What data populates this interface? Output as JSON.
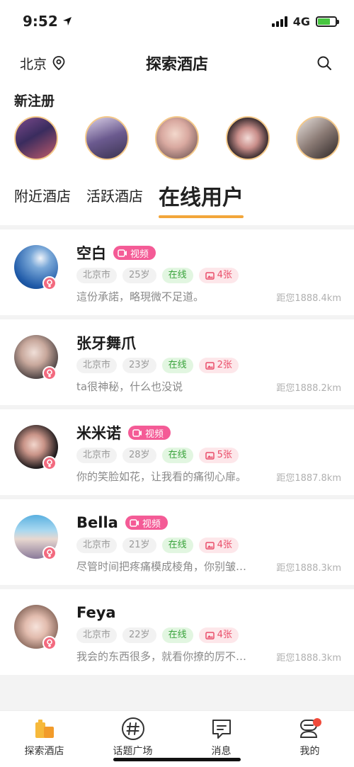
{
  "status_bar": {
    "time": "9:52",
    "network": "4G"
  },
  "header": {
    "city": "北京",
    "title": "探索酒店"
  },
  "new_users": {
    "title": "新注册"
  },
  "tabs": [
    {
      "label": "附近酒店"
    },
    {
      "label": "活跃酒店"
    },
    {
      "label": "在线用户"
    }
  ],
  "colors": {
    "accent": "#f2a63a",
    "video_badge": "#f45b96",
    "online": "#3ba43d",
    "photos": "#ea4e6a",
    "gender": "#f36a7f"
  },
  "users": [
    {
      "name": "空白",
      "video": "视频",
      "city": "北京市",
      "age": "25岁",
      "status": "在线",
      "photos": "4张",
      "signature": "這份承諾，略現微不足道。",
      "distance": "距您1888.4km"
    },
    {
      "name": "张牙舞爪",
      "video": "",
      "city": "北京市",
      "age": "23岁",
      "status": "在线",
      "photos": "2张",
      "signature": "ta很神秘，什么也没说",
      "distance": "距您1888.2km"
    },
    {
      "name": "米米诺",
      "video": "视频",
      "city": "北京市",
      "age": "28岁",
      "status": "在线",
      "photos": "5张",
      "signature": "你的笑脸如花，让我看的痛彻心扉。",
      "distance": "距您1887.8km"
    },
    {
      "name": "Bella",
      "video": "视频",
      "city": "北京市",
      "age": "21岁",
      "status": "在线",
      "photos": "4张",
      "signature": "尽管时间把疼痛模成棱角，你别皱…",
      "distance": "距您1888.3km"
    },
    {
      "name": "Feya",
      "video": "",
      "city": "北京市",
      "age": "22岁",
      "status": "在线",
      "photos": "4张",
      "signature": "我会的东西很多，就看你撩的厉不…",
      "distance": "距您1888.3km"
    }
  ],
  "tabbar": [
    {
      "label": "探索酒店"
    },
    {
      "label": "话题广场"
    },
    {
      "label": "消息"
    },
    {
      "label": "我的"
    }
  ]
}
